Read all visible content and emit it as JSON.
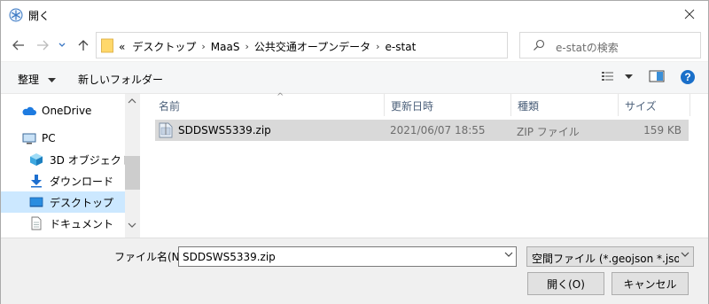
{
  "window": {
    "title": "開く",
    "close_icon": "close-icon"
  },
  "address": {
    "overflow": "«",
    "crumbs": [
      "デスクトップ",
      "MaaS",
      "公共交通オープンデータ",
      "e-stat"
    ],
    "search_placeholder": "e-statの検索"
  },
  "toolbar": {
    "organize_label": "整理",
    "new_folder_label": "新しいフォルダー"
  },
  "nav": {
    "items": [
      {
        "label": "OneDrive",
        "icon": "cloud-icon"
      },
      {
        "label": "PC",
        "icon": "pc-icon"
      },
      {
        "label": "3D オブジェクト",
        "icon": "3d-objects-icon"
      },
      {
        "label": "ダウンロード",
        "icon": "download-icon"
      },
      {
        "label": "デスクトップ",
        "icon": "desktop-icon",
        "selected": true
      },
      {
        "label": "ドキュメント",
        "icon": "document-icon"
      }
    ]
  },
  "filelist": {
    "columns": [
      "名前",
      "更新日時",
      "種類",
      "サイズ"
    ],
    "rows": [
      {
        "name": "SDDSWS5339.zip",
        "modified": "2021/06/07 18:55",
        "type": "ZIP ファイル",
        "size": "159 KB"
      }
    ]
  },
  "bottom": {
    "filename_label": "ファイル名(N):",
    "filename_value": "SDDSWS5339.zip",
    "filter_value": "空間ファイル (*.geojson *.json *.k",
    "open_label": "開く(O)",
    "cancel_label": "キャンセル"
  },
  "colors": {
    "selection": "#cce8ff",
    "row_selected": "#d9d9d9",
    "accent": "#0078d7"
  }
}
